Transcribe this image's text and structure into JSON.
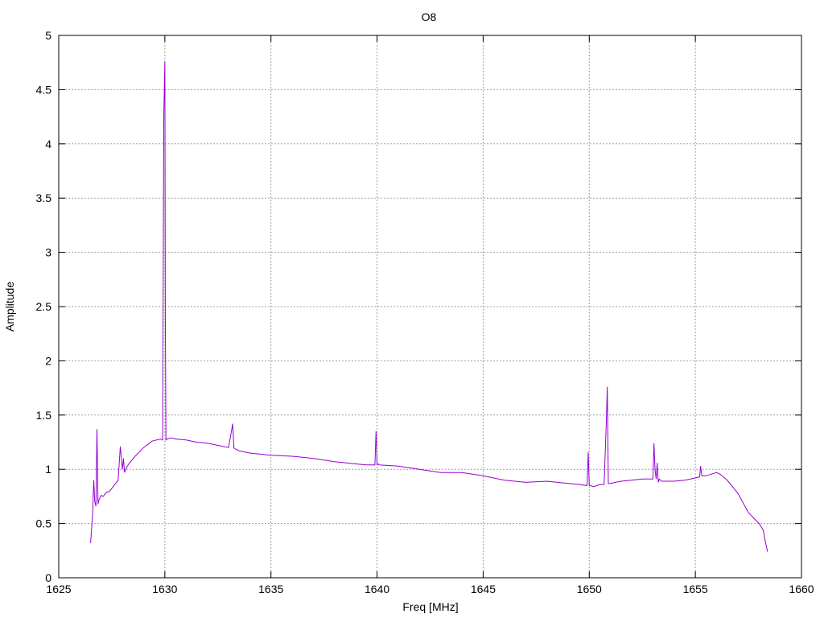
{
  "chart_data": {
    "type": "line",
    "title": "O8",
    "xlabel": "Freq [MHz]",
    "ylabel": "Amplitude",
    "xlim": [
      1625,
      1660
    ],
    "ylim": [
      0,
      5
    ],
    "x_ticks": [
      "1625",
      "1630",
      "1635",
      "1640",
      "1645",
      "1650",
      "1655",
      "1660"
    ],
    "y_ticks": [
      "0",
      "0.5",
      "1",
      "1.5",
      "2",
      "2.5",
      "3",
      "3.5",
      "4",
      "4.5",
      "5"
    ],
    "grid": true,
    "line_color": "#9400d3",
    "series": [
      {
        "x": [
          1626.5,
          1626.6,
          1626.65,
          1626.7,
          1626.75,
          1626.8,
          1626.85,
          1626.9,
          1627.0,
          1627.1,
          1627.2,
          1627.4,
          1627.6,
          1627.8,
          1627.9,
          1628.0,
          1628.05,
          1628.1,
          1628.15,
          1628.3,
          1628.6,
          1629.0,
          1629.4,
          1629.8,
          1629.9,
          1629.95,
          1630.0,
          1630.02,
          1630.05,
          1630.1,
          1630.3,
          1630.5,
          1631.0,
          1631.5,
          1632.0,
          1632.5,
          1633.0,
          1633.2,
          1633.25,
          1633.3,
          1633.5,
          1634.0,
          1635.0,
          1636.0,
          1637.0,
          1638.0,
          1638.5,
          1639.0,
          1639.5,
          1639.9,
          1639.95,
          1640.0,
          1640.05,
          1640.1,
          1641.0,
          1642.0,
          1643.0,
          1644.0,
          1645.0,
          1646.0,
          1647.0,
          1648.0,
          1649.0,
          1649.5,
          1649.9,
          1649.95,
          1650.0,
          1650.05,
          1650.2,
          1650.5,
          1650.7,
          1650.8,
          1650.85,
          1650.9,
          1651.0,
          1651.5,
          1652.0,
          1652.5,
          1653.0,
          1653.05,
          1653.1,
          1653.15,
          1653.2,
          1653.25,
          1653.3,
          1653.35,
          1653.4,
          1654.0,
          1654.5,
          1655.0,
          1655.2,
          1655.25,
          1655.3,
          1655.5,
          1656.0,
          1656.2,
          1656.5,
          1657.0,
          1657.5,
          1658.0,
          1658.2,
          1658.3,
          1658.4
        ],
        "y": [
          0.32,
          0.6,
          0.9,
          0.7,
          0.66,
          1.37,
          0.68,
          0.72,
          0.76,
          0.75,
          0.78,
          0.8,
          0.85,
          0.9,
          1.21,
          1.0,
          1.1,
          0.97,
          1.0,
          1.05,
          1.12,
          1.2,
          1.26,
          1.28,
          1.27,
          4.25,
          4.76,
          2.5,
          1.27,
          1.28,
          1.29,
          1.28,
          1.27,
          1.25,
          1.24,
          1.22,
          1.2,
          1.42,
          1.2,
          1.19,
          1.17,
          1.15,
          1.13,
          1.12,
          1.1,
          1.07,
          1.06,
          1.05,
          1.04,
          1.04,
          1.35,
          1.04,
          1.05,
          1.04,
          1.03,
          1.0,
          0.97,
          0.97,
          0.94,
          0.9,
          0.88,
          0.89,
          0.87,
          0.86,
          0.85,
          1.16,
          0.85,
          0.85,
          0.84,
          0.86,
          0.86,
          1.42,
          1.76,
          0.87,
          0.87,
          0.89,
          0.9,
          0.91,
          0.91,
          1.24,
          1.0,
          0.91,
          1.06,
          0.88,
          0.91,
          0.9,
          0.89,
          0.89,
          0.9,
          0.92,
          0.93,
          1.03,
          0.94,
          0.94,
          0.97,
          0.95,
          0.9,
          0.78,
          0.6,
          0.5,
          0.44,
          0.33,
          0.24
        ]
      }
    ]
  }
}
